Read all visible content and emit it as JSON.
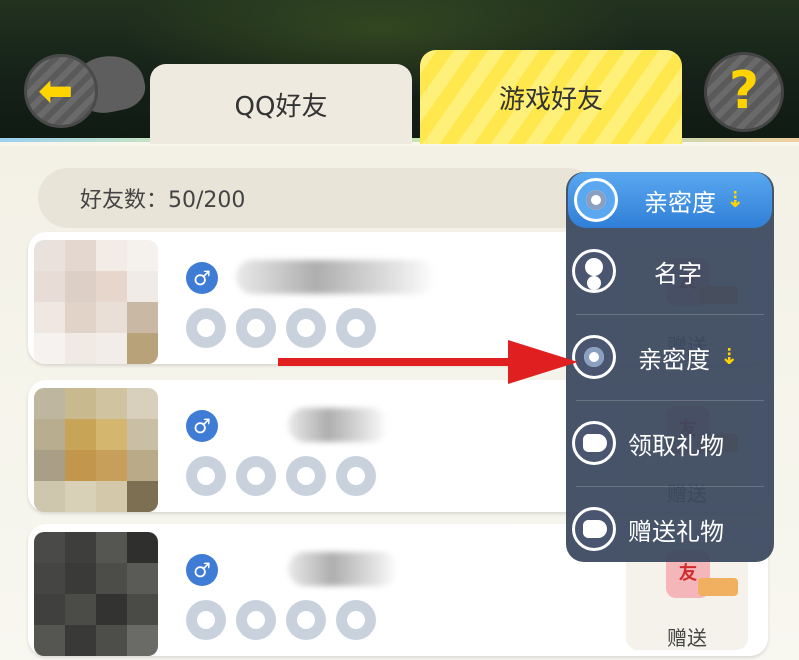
{
  "header": {
    "back_icon": "arrow-left-icon",
    "help_icon": "question-icon",
    "help_glyph": "?",
    "tabs": [
      {
        "label": "QQ好友",
        "active": false
      },
      {
        "label": "游戏好友",
        "active": true
      }
    ]
  },
  "friends_count": "好友数：50/200",
  "friends": [
    {
      "gender": "♂",
      "affinity_level": 0,
      "gift_label": "赠送"
    },
    {
      "gender": "♂",
      "affinity_level": 0,
      "gift_label": "赠送"
    },
    {
      "gender": "♂",
      "affinity_level": 0,
      "gift_label": "赠送"
    }
  ],
  "sort_menu": {
    "selected": "亲密度",
    "selected_arrow": "⇣",
    "options": [
      {
        "label": "名字",
        "icon": "person-icon"
      },
      {
        "label": "亲密度",
        "icon": "flower-icon",
        "arrow": "⇣"
      },
      {
        "label": "领取礼物",
        "icon": "receive-gift-icon"
      },
      {
        "label": "赠送礼物",
        "icon": "send-gift-icon"
      }
    ]
  },
  "colors": {
    "accent_yellow": "#ffd400",
    "menu_bg": "#3c485f",
    "menu_selected": "#2f7fd8",
    "annotation_arrow": "#e02020"
  }
}
